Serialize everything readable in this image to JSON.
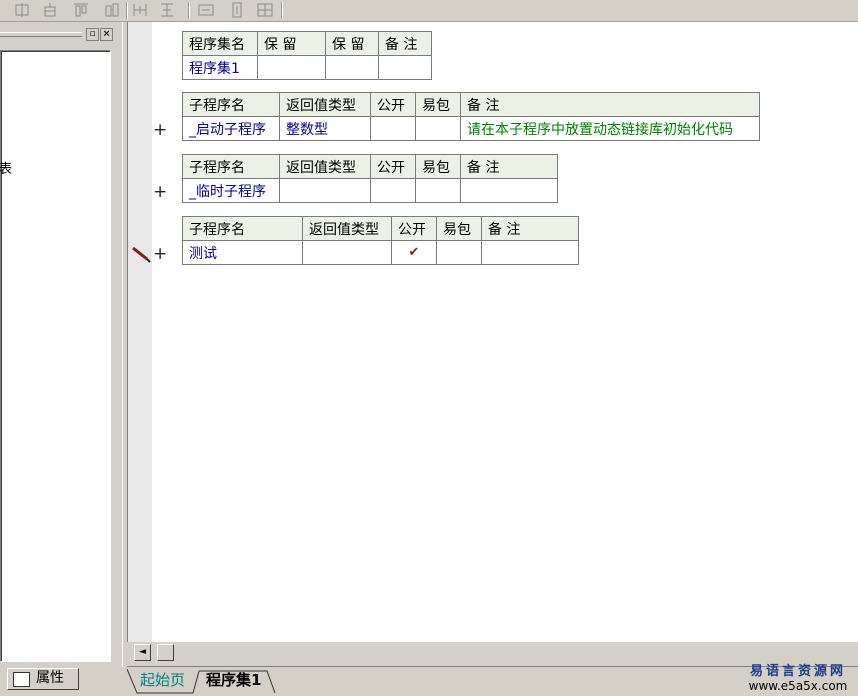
{
  "toolbar": {
    "icons": [
      "align-left-icon",
      "align-center-icon",
      "align-top-icon",
      "align-middle-icon",
      "same-width-icon",
      "same-height-icon",
      "h-spacing-icon",
      "v-spacing-icon",
      "center-icon"
    ]
  },
  "left_panel": {
    "tree_truncated_text": "表",
    "properties_tab_label": "属性"
  },
  "editor": {
    "set_table": {
      "headers": [
        "程序集名",
        "保 留",
        "保 留",
        "备 注"
      ],
      "row": [
        "程序集1",
        "",
        "",
        ""
      ]
    },
    "subroutines": [
      {
        "headers": [
          "子程序名",
          "返回值类型",
          "公开",
          "易包",
          "备 注"
        ],
        "name": "_启动子程序",
        "return_type": "整数型",
        "public": "",
        "easy_pack": "",
        "comment": "请在本子程序中放置动态链接库初始化代码",
        "marker": "+"
      },
      {
        "headers": [
          "子程序名",
          "返回值类型",
          "公开",
          "易包",
          "备 注"
        ],
        "name": "_临时子程序",
        "return_type": "",
        "public": "",
        "easy_pack": "",
        "comment": "",
        "marker": "+"
      },
      {
        "headers": [
          "子程序名",
          "返回值类型",
          "公开",
          "易包",
          "备 注"
        ],
        "name": "测试",
        "return_type": "",
        "public": "✔",
        "easy_pack": "",
        "comment": "",
        "marker": "+"
      }
    ]
  },
  "tabs": {
    "home": "起始页",
    "program_set": "程序集1"
  },
  "watermark": {
    "title": "易语言资源网",
    "url": "www.e5a5x.com"
  },
  "colors": {
    "header_bg": "#ecf1e6",
    "name_text": "#00009a",
    "comment_text": "#008000",
    "check_mark": "#8b1a1a",
    "tab_home_text": "#008080"
  }
}
